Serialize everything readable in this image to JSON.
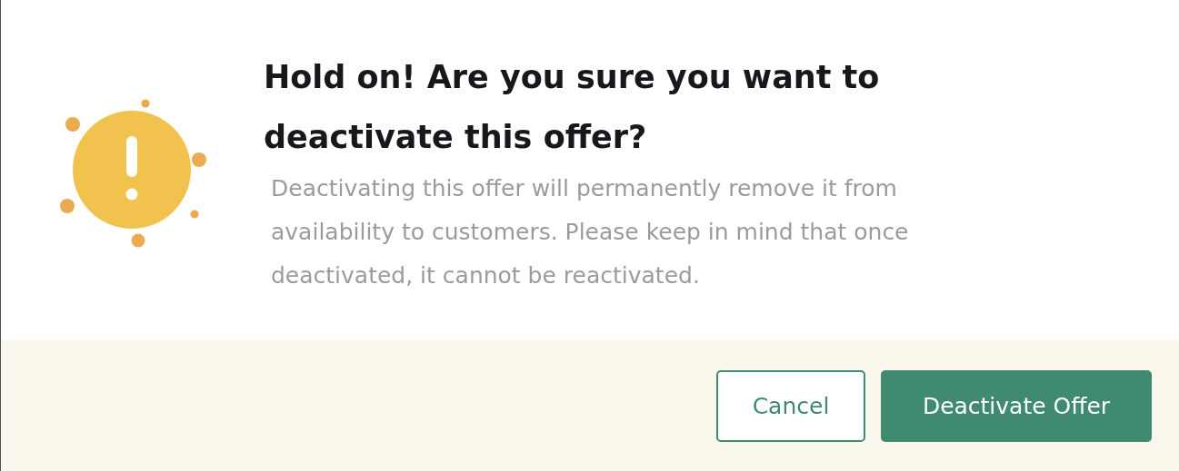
{
  "dialog": {
    "title": "Hold on! Are you sure you want to deactivate this offer?",
    "message": "Deactivating this offer will permanently remove it from availability to customers. Please keep in mind that once deactivated, it cannot be reactivated.",
    "buttons": [
      {
        "label": "Cancel",
        "kind": "secondary"
      },
      {
        "label": "Deactivate Offer",
        "kind": "primary"
      }
    ]
  }
}
